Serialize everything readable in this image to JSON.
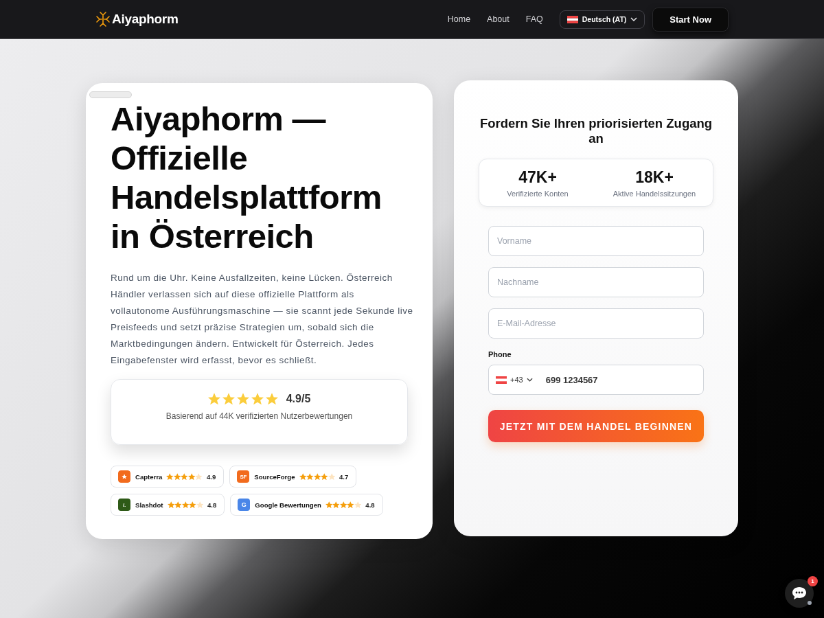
{
  "header": {
    "logo": "Aiyaphorm",
    "nav": [
      {
        "label": "Home"
      },
      {
        "label": "About"
      },
      {
        "label": "FAQ"
      }
    ],
    "language": "Deutsch (AT)",
    "cta": "Start Now"
  },
  "hero": {
    "title": "Aiyaphorm — Offizielle Handelsplattform in Österreich",
    "text": "Rund um die Uhr. Keine Ausfallzeiten, keine Lücken. Österreich Händler verlassen sich auf diese offizielle Plattform als vollautonome Ausführungsmaschine — sie scannt jede Sekunde live Preisfeeds und setzt präzise Strategien um, sobald sich die Marktbedingungen ändern. Entwickelt für Österreich. Jedes Eingabefenster wird erfasst, bevor es schließt.",
    "rating": {
      "stars": 5,
      "score": "4.9/5",
      "caption": "Basierend auf 44K verifizierten Nutzerbewertungen"
    },
    "badges": [
      {
        "name": "Capterra",
        "kind": "star",
        "color": "#f26b1d",
        "stars": 4,
        "rating": "4.9"
      },
      {
        "name": "SourceForge",
        "kind": "letters",
        "logo": "SF",
        "color": "#f26b1d",
        "stars": 4,
        "rating": "4.7"
      },
      {
        "name": "Slashdot",
        "kind": "letters",
        "logo": "/.",
        "color": "#2e5a17",
        "stars": 4,
        "rating": "4.8"
      },
      {
        "name": "Google Bewertungen",
        "kind": "letters",
        "logo": "G",
        "color": "#4a86e8",
        "stars": 4,
        "rating": "4.8"
      }
    ]
  },
  "signup": {
    "title": "Fordern Sie Ihren priorisierten Zugang an",
    "stats": [
      {
        "value": "47K+",
        "label": "Verifizierte Konten"
      },
      {
        "value": "18K+",
        "label": "Aktive Handelssitzungen"
      }
    ],
    "fields": [
      {
        "placeholder": "Vorname"
      },
      {
        "placeholder": "Nachname"
      },
      {
        "placeholder": "E-Mail-Adresse"
      }
    ],
    "phone": {
      "label": "Phone",
      "code": "+43",
      "value": "699 1234567"
    },
    "submit": "JETZT MIT DEM HANDEL BEGINNEN"
  },
  "chat": {
    "badge": "1"
  }
}
